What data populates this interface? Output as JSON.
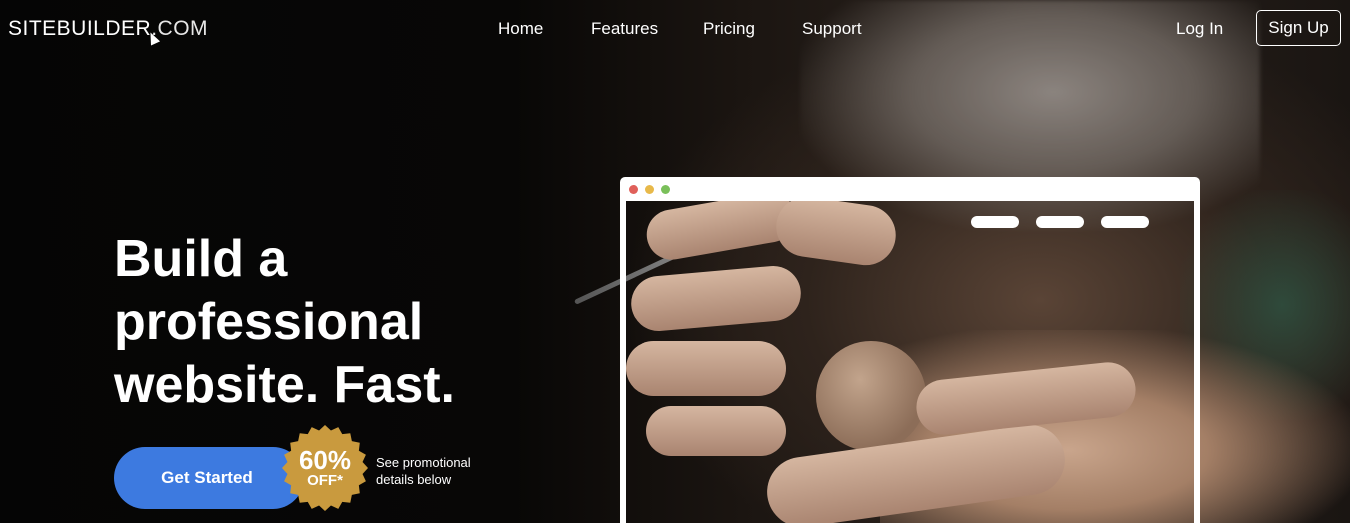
{
  "brand": {
    "logo_main": "SITEBUILDER",
    "logo_suffix": ".COM"
  },
  "nav": {
    "links": [
      "Home",
      "Features",
      "Pricing",
      "Support"
    ],
    "login": "Log In",
    "signup": "Sign Up"
  },
  "hero": {
    "headline_line1": "Build a",
    "headline_line2": "professional",
    "headline_line3": "website. Fast.",
    "cta": "Get Started",
    "badge_percent": "60%",
    "badge_off": "OFF*",
    "promo_line1": "See promotional",
    "promo_line2": "details below"
  },
  "colors": {
    "cta": "#3d7ae0",
    "badge": "#c99a3e",
    "dot_red": "#e0605a",
    "dot_yellow": "#e8b94a",
    "dot_green": "#7ac05a"
  }
}
